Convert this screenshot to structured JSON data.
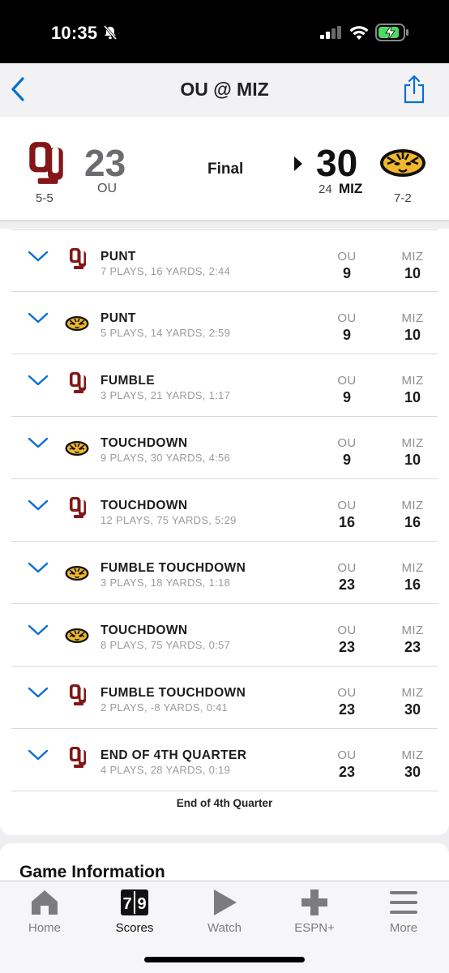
{
  "status_bar": {
    "time": "10:35"
  },
  "nav": {
    "title": "OU @ MIZ"
  },
  "header": {
    "away": {
      "abbr": "OU",
      "score": "23",
      "record": "5-5"
    },
    "home": {
      "abbr": "MIZ",
      "score": "30",
      "record": "7-2",
      "rank": "24"
    },
    "status": "Final"
  },
  "colors": {
    "ou_crimson": "#841617",
    "miz_gold": "#f1b82d",
    "accent_blue": "#0a6fd1"
  },
  "drives": {
    "col_away": "OU",
    "col_home": "MIZ",
    "items": [
      {
        "team": "ou",
        "result": "PUNT",
        "detail": "7 PLAYS, 16 YARDS, 2:44",
        "away_score": "9",
        "home_score": "10"
      },
      {
        "team": "miz",
        "result": "PUNT",
        "detail": "5 PLAYS, 14 YARDS, 2:59",
        "away_score": "9",
        "home_score": "10"
      },
      {
        "team": "ou",
        "result": "FUMBLE",
        "detail": "3 PLAYS, 21 YARDS, 1:17",
        "away_score": "9",
        "home_score": "10"
      },
      {
        "team": "miz",
        "result": "TOUCHDOWN",
        "detail": "9 PLAYS, 30 YARDS, 4:56",
        "away_score": "9",
        "home_score": "10"
      },
      {
        "team": "ou",
        "result": "TOUCHDOWN",
        "detail": "12 PLAYS, 75 YARDS, 5:29",
        "away_score": "16",
        "home_score": "16"
      },
      {
        "team": "miz",
        "result": "FUMBLE TOUCHDOWN",
        "detail": "3 PLAYS, 18 YARDS, 1:18",
        "away_score": "23",
        "home_score": "16"
      },
      {
        "team": "miz",
        "result": "TOUCHDOWN",
        "detail": "8 PLAYS, 75 YARDS, 0:57",
        "away_score": "23",
        "home_score": "23"
      },
      {
        "team": "ou",
        "result": "FUMBLE TOUCHDOWN",
        "detail": "2 PLAYS, -8 YARDS, 0:41",
        "away_score": "23",
        "home_score": "30"
      },
      {
        "team": "ou",
        "result": "END OF 4TH QUARTER",
        "detail": "4 PLAYS, 28 YARDS, 0:19",
        "away_score": "23",
        "home_score": "30"
      }
    ],
    "footer": "End of 4th Quarter"
  },
  "game_info": {
    "title": "Game Information"
  },
  "tabs": [
    {
      "label": "Home",
      "icon": "house-icon",
      "active": false
    },
    {
      "label": "Scores",
      "icon": "scoreboard-icon",
      "active": true
    },
    {
      "label": "Watch",
      "icon": "play-icon",
      "active": false
    },
    {
      "label": "ESPN+",
      "icon": "plus-icon",
      "active": false
    },
    {
      "label": "More",
      "icon": "menu-icon",
      "active": false
    }
  ]
}
